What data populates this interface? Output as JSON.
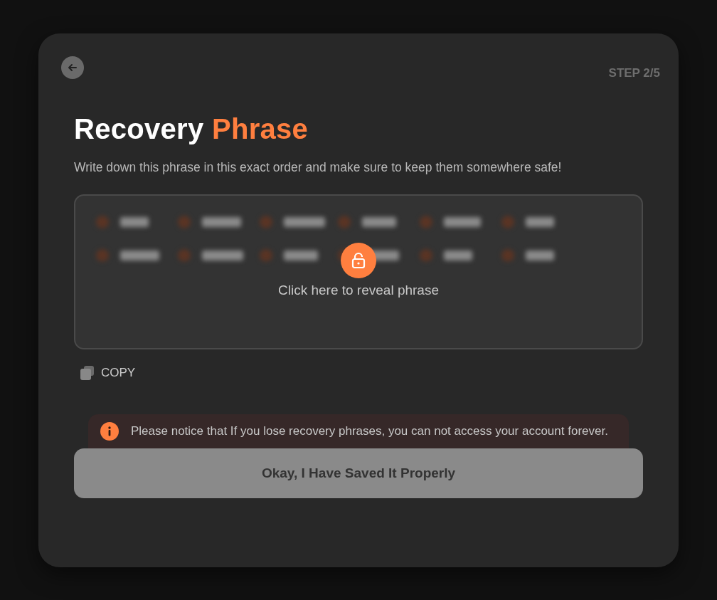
{
  "step": "STEP 2/5",
  "title": {
    "main": "Recovery",
    "accent": "Phrase"
  },
  "description": "Write down this phrase in this exact order and make sure to keep them somewhere safe!",
  "phrase_box": {
    "revealed": false,
    "hint": "Click here to reveal phrase"
  },
  "copy": {
    "label": "COPY"
  },
  "warning": "Please notice that If you lose recovery phrases, you can not access your account forever.",
  "confirm_button": {
    "label": "Okay, I Have Saved It Properly",
    "disabled": true
  }
}
